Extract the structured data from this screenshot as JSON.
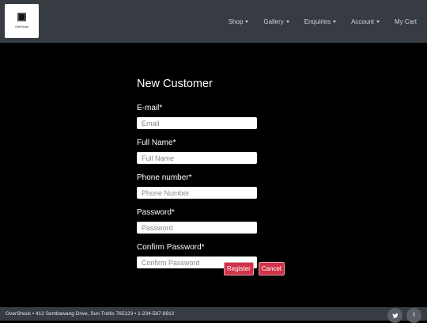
{
  "brand": {
    "logo_text": "OverShock"
  },
  "nav": {
    "items": [
      {
        "label": "Shop",
        "dropdown": true
      },
      {
        "label": "Gallery",
        "dropdown": true
      },
      {
        "label": "Enquiries",
        "dropdown": true
      },
      {
        "label": "Account",
        "dropdown": true
      },
      {
        "label": "My Cart",
        "dropdown": false
      }
    ]
  },
  "form": {
    "title": "New Customer",
    "fields": [
      {
        "label": "E-mail*",
        "placeholder": "Email",
        "value": ""
      },
      {
        "label": "Full Name*",
        "placeholder": "Full Name",
        "value": ""
      },
      {
        "label": "Phone number*",
        "placeholder": "Phone Number",
        "value": ""
      },
      {
        "label": "Password*",
        "placeholder": "Password",
        "value": ""
      },
      {
        "label": "Confirm Password*",
        "placeholder": "Confirm Password",
        "value": ""
      }
    ],
    "register_label": "Register",
    "cancel_label": "Cancel"
  },
  "footer": {
    "address": "OverShock • 412 Sembawang Drive, Sun Trellis   765123 • 1-234-567-8912",
    "social": [
      {
        "icon": "twitter-icon",
        "glyph": "🐦"
      },
      {
        "icon": "facebook-icon",
        "glyph": "f"
      }
    ]
  },
  "colors": {
    "navbar_bg": "#373c43",
    "page_bg": "#000000",
    "button_bg": "#d1344a"
  }
}
